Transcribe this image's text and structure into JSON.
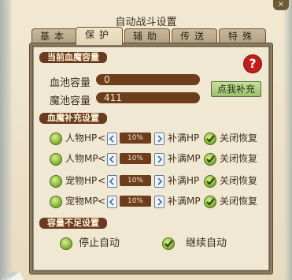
{
  "window": {
    "title": "自动战斗设置",
    "close_label": "×"
  },
  "tabs": [
    {
      "label": "基本",
      "active": false
    },
    {
      "label": "保护",
      "active": true
    },
    {
      "label": "辅助",
      "active": false
    },
    {
      "label": "传送",
      "active": false
    },
    {
      "label": "特殊",
      "active": false
    }
  ],
  "capacity": {
    "header": "当前血魔容量",
    "hp_label": "血池容量",
    "hp_value": "0",
    "mp_label": "魔池容量",
    "mp_value": "411",
    "help_icon": "?",
    "refill_button": "点我补充"
  },
  "refill_settings": {
    "header": "血魔补充设置",
    "rows": [
      {
        "target": "人物HP",
        "percent": "10%",
        "action": "补满HP",
        "toggle": "关闭恢复"
      },
      {
        "target": "人物MP",
        "percent": "10%",
        "action": "补满MP",
        "toggle": "关闭恢复"
      },
      {
        "target": "宠物HP",
        "percent": "10%",
        "action": "补满HP",
        "toggle": "关闭恢复"
      },
      {
        "target": "宠物MP",
        "percent": "10%",
        "action": "补满MP",
        "toggle": "关闭恢复"
      }
    ],
    "less_than_symbol": "<"
  },
  "insufficient": {
    "header": "容量不足设置",
    "stop_label": "停止自动",
    "continue_label": "继续自动"
  }
}
